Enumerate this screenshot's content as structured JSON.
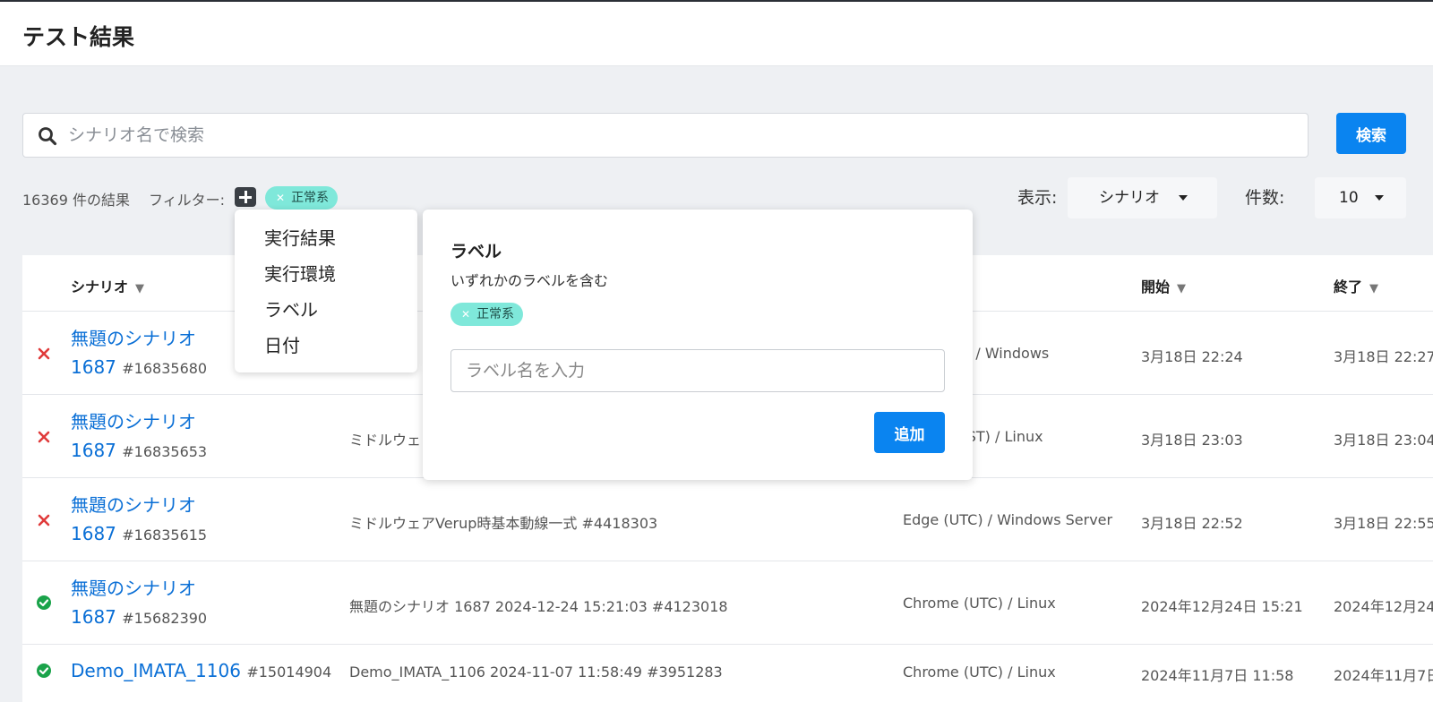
{
  "page": {
    "title": "テスト結果"
  },
  "search": {
    "placeholder": "シナリオ名で検索",
    "button_label": "検索"
  },
  "filter_bar": {
    "result_count": "16369 件の結果",
    "filter_label": "フィルター:",
    "active_chip": "正常系",
    "display_label": "表示:",
    "display_value": "シナリオ",
    "count_label": "件数:",
    "count_value": "10"
  },
  "filter_menu": {
    "items": [
      "実行結果",
      "実行環境",
      "ラベル",
      "日付"
    ]
  },
  "label_popover": {
    "title": "ラベル",
    "subtitle": "いずれかのラベルを含む",
    "chip": "正常系",
    "input_placeholder": "ラベル名を入力",
    "add_label": "追加"
  },
  "table": {
    "headers": {
      "scenario": "シナリオ",
      "start": "開始",
      "end": "終了"
    },
    "sort_icon": "▼",
    "rows": [
      {
        "status": "failed",
        "name_line1": "無題のシナリオ",
        "name_line2": "1687",
        "id": "#16835680",
        "plan": "",
        "env": "TC) / Windows",
        "start": "3月18日 22:24",
        "end": "3月18日 22:27"
      },
      {
        "status": "failed",
        "name_line1": "無題のシナリオ",
        "name_line2": "1687",
        "id": "#16835653",
        "plan": "ミドルウェ",
        "env": "IST) / Linux",
        "start": "3月18日 23:03",
        "end": "3月18日 23:04"
      },
      {
        "status": "failed",
        "name_line1": "無題のシナリオ",
        "name_line2": "1687",
        "id": "#16835615",
        "plan": "ミドルウェアVerup時基本動線一式 #4418303",
        "env": "Edge (UTC) / Windows Server",
        "start": "3月18日 22:52",
        "end": "3月18日 22:55"
      },
      {
        "status": "passed",
        "name_line1": "無題のシナリオ",
        "name_line2": "1687",
        "id": "#15682390",
        "plan": "無題のシナリオ 1687 2024-12-24 15:21:03 #4123018",
        "env": "Chrome (UTC) / Linux",
        "start": "2024年12月24日 15:21",
        "end": "2024年12月24"
      },
      {
        "status": "passed",
        "name_line1": "Demo_IMATA_1106",
        "name_line2": "",
        "id": "#15014904",
        "plan": "Demo_IMATA_1106 2024-11-07 11:58:49 #3951283",
        "env": "Chrome (UTC) / Linux",
        "start": "2024年11月7日 11:58",
        "end": "2024年11月7日"
      }
    ]
  },
  "colors": {
    "accent": "#0a84f0",
    "chip": "#7fe8da",
    "failed": "#e03a3a",
    "passed": "#1aa34a",
    "link": "#0a6fd6"
  }
}
